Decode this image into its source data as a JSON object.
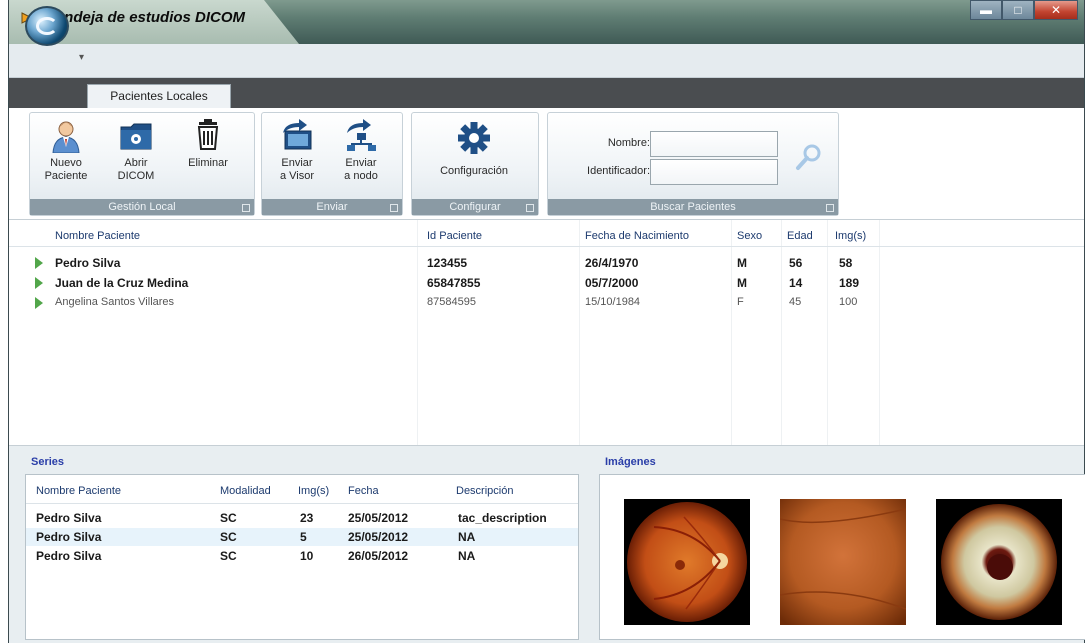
{
  "window": {
    "title": "Bandeja de estudios DICOM",
    "controls": {
      "minimize": "▬",
      "maximize": "□",
      "close": "✕"
    }
  },
  "tabs": [
    {
      "label": "Pacientes Locales",
      "active": true
    }
  ],
  "ribbon": {
    "groups": [
      {
        "label": "Gestión Local",
        "buttons": [
          {
            "label_line1": "Nuevo",
            "label_line2": "Paciente",
            "icon": "user-icon"
          },
          {
            "label_line1": "Abrir",
            "label_line2": "DICOM",
            "icon": "folder-icon"
          },
          {
            "label_line1": "Eliminar",
            "label_line2": "",
            "icon": "trash-icon"
          }
        ]
      },
      {
        "label": "Enviar",
        "buttons": [
          {
            "label_line1": "Enviar",
            "label_line2": "a Visor",
            "icon": "send-to-viewer-icon"
          },
          {
            "label_line1": "Enviar",
            "label_line2": "a nodo",
            "icon": "send-to-node-icon"
          }
        ]
      },
      {
        "label": "Configurar",
        "buttons": [
          {
            "label_line1": "Configuración",
            "label_line2": "",
            "icon": "gear-icon"
          }
        ]
      },
      {
        "label": "Buscar Pacientes",
        "fields": [
          {
            "label": "Nombre:",
            "value": ""
          },
          {
            "label": "Identificador:",
            "value": ""
          }
        ],
        "search_icon": "search-icon"
      }
    ]
  },
  "patients": {
    "columns": [
      "Nombre Paciente",
      "Id Paciente",
      "Fecha de Nacimiento",
      "Sexo",
      "Edad",
      "Img(s)"
    ],
    "rows": [
      {
        "name": "Pedro Silva",
        "id": "123455",
        "birth": "26/4/1970",
        "sex": "M",
        "age": "56",
        "imgs": "58",
        "style": "bold"
      },
      {
        "name": "Juan de la Cruz Medina",
        "id": "65847855",
        "birth": "05/7/2000",
        "sex": "M",
        "age": "14",
        "imgs": "189",
        "style": "bold"
      },
      {
        "name": "Angelina Santos Villares",
        "id": "87584595",
        "birth": "15/10/1984",
        "sex": "F",
        "age": "45",
        "imgs": "100",
        "style": "light"
      }
    ]
  },
  "series": {
    "title": "Series",
    "columns": [
      "Nombre Paciente",
      "Modalidad",
      "Img(s)",
      "Fecha",
      "Descripción"
    ],
    "rows": [
      {
        "name": "Pedro Silva",
        "modality": "SC",
        "imgs": "23",
        "date": "25/05/2012",
        "desc": "tac_description"
      },
      {
        "name": "Pedro Silva",
        "modality": "SC",
        "imgs": "5",
        "date": "25/05/2012",
        "desc": "NA"
      },
      {
        "name": "Pedro Silva",
        "modality": "SC",
        "imgs": "10",
        "date": "26/05/2012",
        "desc": "NA"
      }
    ]
  },
  "images": {
    "title": "Imágenes",
    "thumbnails": [
      "retina-fundus",
      "retina-closeup",
      "eye-anterior"
    ]
  },
  "colors": {
    "accent": "#2a3ea8",
    "header_text": "#1c3a6e",
    "row_arrow": "#52a64a",
    "ribbon_label": "#8a9aa4"
  }
}
